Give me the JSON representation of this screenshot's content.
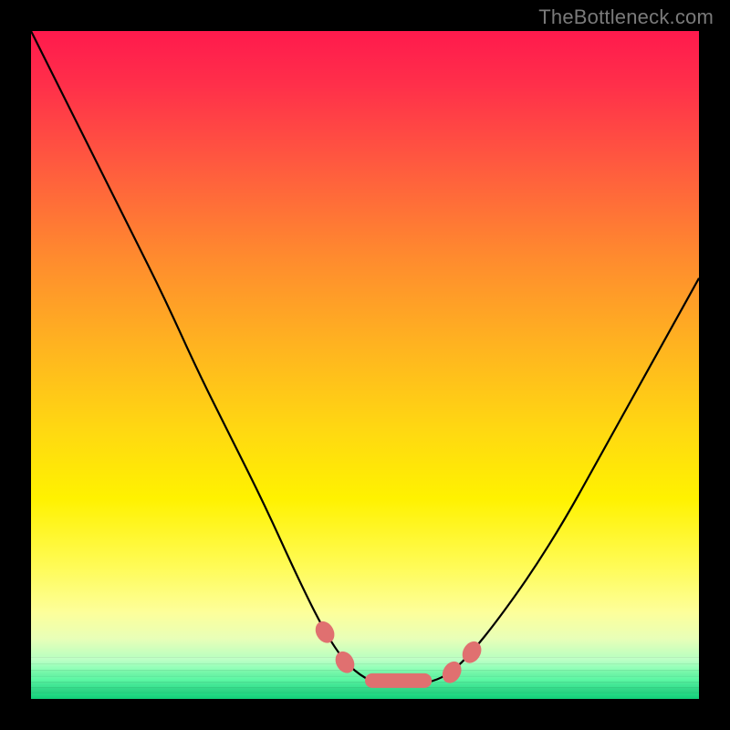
{
  "attribution": "TheBottleneck.com",
  "colors": {
    "frame": "#000000",
    "curve": "#000000",
    "knot": "#e07070",
    "gradient_stops": [
      "#ff1a4d",
      "#ff2f4a",
      "#ff5a3f",
      "#ff8b2e",
      "#ffb61f",
      "#ffd911",
      "#fff200",
      "#fffb55",
      "#fdff9a",
      "#e8ffb8",
      "#b8ffc0",
      "#7affb0",
      "#44ee99",
      "#12d47c"
    ]
  },
  "chart_data": {
    "type": "line",
    "title": "",
    "xlabel": "",
    "ylabel": "",
    "xlim": [
      0,
      100
    ],
    "ylim": [
      0,
      100
    ],
    "grid": false,
    "legend": false,
    "series": [
      {
        "name": "curve",
        "x": [
          0,
          5,
          10,
          15,
          20,
          25,
          30,
          35,
          40,
          44,
          47,
          50,
          53,
          56,
          60,
          63,
          66,
          70,
          75,
          80,
          85,
          90,
          95,
          100
        ],
        "y": [
          100,
          90,
          80,
          70,
          60,
          49,
          39,
          29,
          18,
          10,
          5.5,
          3,
          2,
          2,
          2.5,
          4,
          7,
          12,
          19,
          27,
          36,
          45,
          54,
          63
        ]
      }
    ],
    "annotations": {
      "knot_points_x": [
        44,
        47,
        63,
        66
      ],
      "flat_segment_x": [
        50,
        60
      ]
    }
  }
}
